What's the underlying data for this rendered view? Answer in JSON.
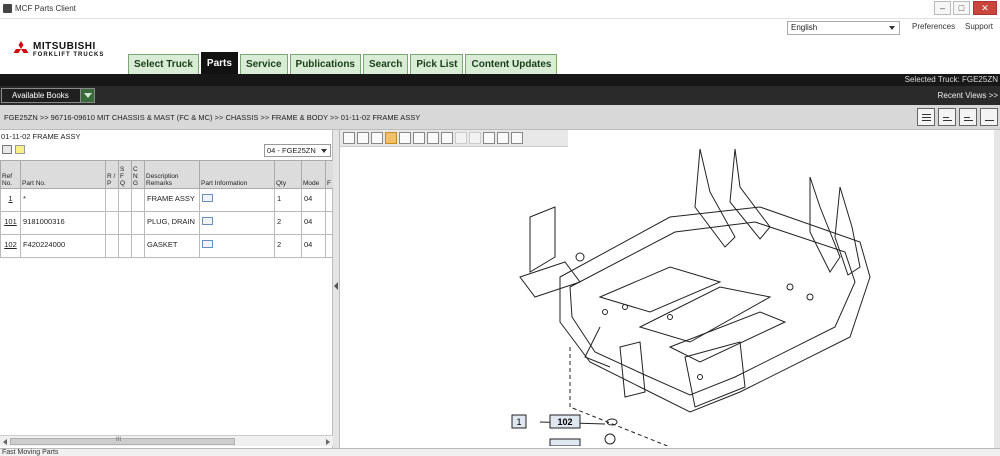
{
  "window": {
    "title": "MCF Parts Client"
  },
  "logo": {
    "brand": "MITSUBISHI",
    "sub": "FORKLIFT TRUCKS"
  },
  "tabs": [
    {
      "label": "Select Truck",
      "active": false
    },
    {
      "label": "Parts",
      "active": true
    },
    {
      "label": "Service",
      "active": false
    },
    {
      "label": "Publications",
      "active": false
    },
    {
      "label": "Search",
      "active": false
    },
    {
      "label": "Pick List",
      "active": false
    },
    {
      "label": "Content Updates",
      "active": false
    }
  ],
  "header": {
    "language": "English",
    "preferences": "Preferences",
    "support": "Support"
  },
  "selected_truck": "Selected Truck: FGE25ZN",
  "available_books": "Available Books",
  "recent_views": "Recent Views >>",
  "breadcrumb": "FGE25ZN >> 96716-09610 MIT CHASSIS & MAST (FC & MC) >> CHASSIS >> FRAME & BODY >> 01-11-02 FRAME ASSY",
  "parts_panel": {
    "title": "01-11-02 FRAME ASSY",
    "model": "04 - FGE25ZN",
    "columns": [
      "Ref No.",
      "Part No.",
      "R / P",
      "S F Q",
      "C N G",
      "Description Remarks",
      "Part Information",
      "Qty",
      "Mode",
      "F"
    ],
    "rows": [
      {
        "ref": "1",
        "part": "*",
        "desc": "FRAME ASSY",
        "qty": "1",
        "mode": "04"
      },
      {
        "ref": "101",
        "part": "9181000316",
        "desc": "PLUG, DRAIN",
        "qty": "2",
        "mode": "04"
      },
      {
        "ref": "102",
        "part": "F420224000",
        "desc": "GASKET",
        "qty": "2",
        "mode": "04"
      }
    ],
    "scroll_glyph": "III"
  },
  "drawing": {
    "callouts": [
      "1",
      "102"
    ]
  },
  "status": "Fast Moving Parts"
}
